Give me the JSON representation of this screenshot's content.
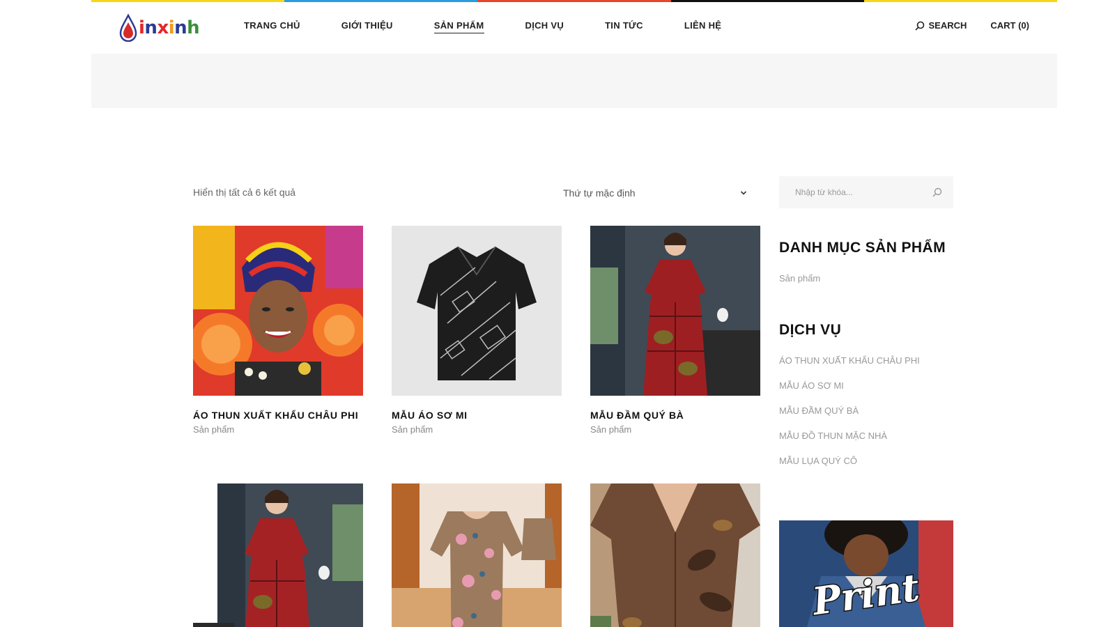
{
  "brand": {
    "logo_text": "inxinh",
    "colors": {
      "drop": "#d42b2b",
      "text_blue": "#2b3a96",
      "text_red": "#e5262b",
      "text_orange": "#f39a1c",
      "text_green": "#3b8f3a"
    }
  },
  "topbar_colors": [
    "#f7d618",
    "#ffffff",
    "#2b9be0",
    "#e8452d",
    "#111111",
    "#f7d618"
  ],
  "nav": {
    "items": [
      {
        "label": "TRANG CHỦ"
      },
      {
        "label": "GIỚI THIỆU"
      },
      {
        "label": "SẢN PHẨM",
        "active": true
      },
      {
        "label": "DỊCH VỤ"
      },
      {
        "label": "TIN TỨC"
      },
      {
        "label": "LIÊN HỆ"
      }
    ],
    "search_label": "SEARCH",
    "cart_label": "CART (0)"
  },
  "shop": {
    "result_count": "Hiển thị tất cả 6 kết quả",
    "sort_selected": "Thứ tự mặc định",
    "products": [
      {
        "title": "ÁO THUN XUẤT KHẨU CHÂU PHI",
        "category": "Sản phẩm",
        "image": "african-woman-portrait"
      },
      {
        "title": "MẪU ÁO SƠ MI",
        "category": "Sản phẩm",
        "image": "black-patterned-shirt"
      },
      {
        "title": "MẪU ĐẦM QUÝ BÀ",
        "category": "Sản phẩm",
        "image": "red-patterned-dress"
      },
      {
        "title": "",
        "category": "",
        "image": "red-dress-model"
      },
      {
        "title": "",
        "category": "",
        "image": "floral-homewear"
      },
      {
        "title": "",
        "category": "",
        "image": "brown-leaf-dress"
      }
    ]
  },
  "sidebar": {
    "search_placeholder": "Nhập từ khóa...",
    "categories_title": "DANH MỤC SẢN PHẨM",
    "categories": [
      "Sản phẩm"
    ],
    "services_title": "DỊCH VỤ",
    "services": [
      "ÁO THUN XUẤT KHẨU CHÂU PHI",
      "MẪU ÁO SƠ MI",
      "MẪU ĐẦM QUÝ BÀ",
      "MẪU ĐỒ THUN MẶC NHÀ",
      "MẪU LỤA QUÝ CÔ"
    ],
    "promo_text": "Print"
  }
}
